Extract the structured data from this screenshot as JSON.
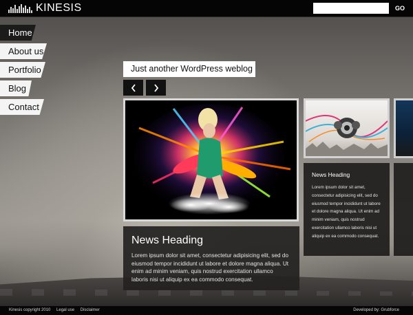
{
  "site": {
    "logo_text": "KINESIS",
    "tagline": "Just another WordPress weblog"
  },
  "search": {
    "value": "",
    "placeholder": "",
    "button_label": "GO"
  },
  "nav": {
    "items": [
      {
        "label": "Home",
        "active": true
      },
      {
        "label": "About us",
        "active": false
      },
      {
        "label": "Portfolio",
        "active": false
      },
      {
        "label": "Blog",
        "active": false
      },
      {
        "label": "Contact",
        "active": false
      }
    ]
  },
  "slider": {
    "prev_icon": "chevron-left-icon",
    "next_icon": "chevron-right-icon"
  },
  "featured": {
    "heading": "News Heading",
    "body": "Lorem ipsum dolor sit amet, consectetur adipisicing elit, sed do eiusmod tempor incididunt ut labore et dolore magna aliqua. Ut enim ad minim veniam, quis nostrud exercitation ullamco laboris nisi ut aliquip ex ea commodo consequat."
  },
  "secondary": {
    "heading": "News Heading",
    "body": "Lorem ipsum dolor sit amet, consectetur adipisicing elit, sed do eiusmod tempor incididunt ut labore et dolore magna aliqua. Ut enim ad minim veniam, quis nostrud exercitation ullamco laboris nisi ut aliquip ex ea commodo consequat."
  },
  "footer": {
    "copyright": "Kinesis copyright 2010",
    "legal_label": "Legal use",
    "disclaimer_label": "Disclaimer",
    "credit": "Developed by: Grubforce"
  },
  "colors": {
    "topbar": "#050505",
    "panel": "#232221",
    "nav_active": "#1b1b1b",
    "nav_inactive": "#f4f4f4"
  }
}
